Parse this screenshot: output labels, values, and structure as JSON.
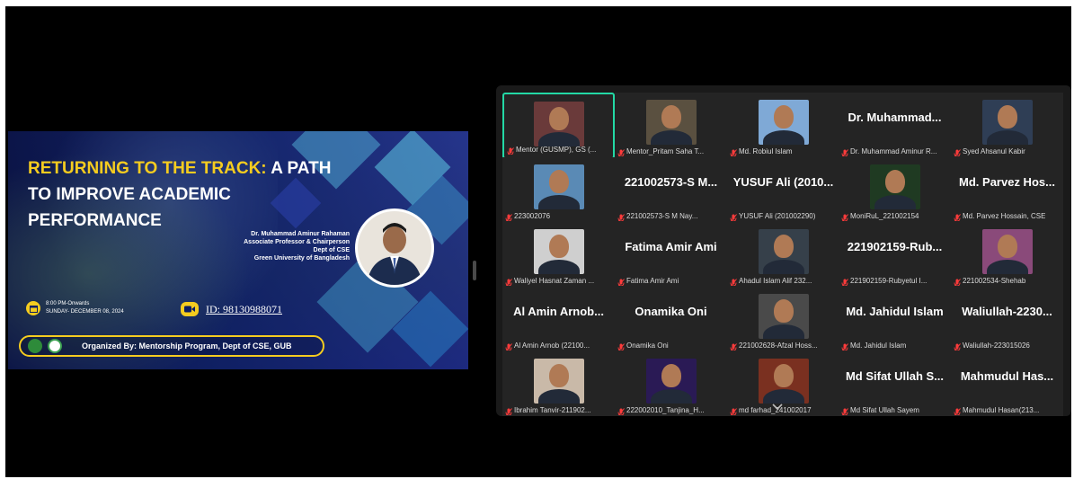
{
  "slide": {
    "title_highlight": "RETURNING TO THE TRACK:",
    "title_rest": " A PATH TO IMPROVE ACADEMIC PERFORMANCE",
    "speaker": {
      "name": "Dr. Muhammad Aminur Rahaman",
      "title": "Associate Professor & Chairperson",
      "dept": "Dept of CSE",
      "university": "Green University of Bangladesh"
    },
    "time": "8:00 PM-Onwards",
    "date": "SUNDAY- DECEMBER 08, 2024",
    "meeting_id": "ID: 98130988071",
    "organizer": "Organized By:  Mentorship Program, Dept of CSE, GUB",
    "colors": {
      "accent": "#f5cc1f",
      "background": "#0b1d63"
    }
  },
  "gallery": {
    "active_border_color": "#23d9a5",
    "tiles": [
      {
        "name": "Mentor (GUSMP), GS (...",
        "big": "",
        "avatar": "#6a3a3a"
      },
      {
        "name": "Mentor_Pritam Saha T...",
        "big": "",
        "avatar": "#5a5040"
      },
      {
        "name": "Md. Robiul Islam",
        "big": "",
        "avatar": "#7fa9d6"
      },
      {
        "name": "Dr. Muhammad Aminur R...",
        "big": "Dr. Muhammad...",
        "avatar": ""
      },
      {
        "name": "Syed Ahsanul Kabir",
        "big": "",
        "avatar": "#2f3e55"
      },
      {
        "name": "223002076",
        "big": "",
        "avatar": "#5a8ab5"
      },
      {
        "name": "221002573-S M Nay...",
        "big": "221002573-S M...",
        "avatar": ""
      },
      {
        "name": "YUSUF Ali (201002290)",
        "big": "YUSUF Ali (2010...",
        "avatar": ""
      },
      {
        "name": "MoniRuL_221002154",
        "big": "",
        "avatar": "#1f3a22"
      },
      {
        "name": "Md. Parvez Hossain, CSE",
        "big": "Md. Parvez Hos...",
        "avatar": ""
      },
      {
        "name": "Waliyel Hasnat Zaman ...",
        "big": "",
        "avatar": "#cfcfcf"
      },
      {
        "name": "Fatima Amir Ami",
        "big": "Fatima Amir Ami",
        "avatar": ""
      },
      {
        "name": "Ahadul Islam Alif 232...",
        "big": "",
        "avatar": "#36404a"
      },
      {
        "name": "221902159-Rubyetul I...",
        "big": "221902159-Rub...",
        "avatar": ""
      },
      {
        "name": "221002534-Shehab",
        "big": "",
        "avatar": "#8a4a7a"
      },
      {
        "name": "Al Amin Arnob (22100...",
        "big": "Al Amin Arnob...",
        "avatar": ""
      },
      {
        "name": "Onamika Oni",
        "big": "Onamika Oni",
        "avatar": ""
      },
      {
        "name": "221002628-Afzal Hoss...",
        "big": "",
        "avatar": "#4a4a4a"
      },
      {
        "name": "Md. Jahidul Islam",
        "big": "Md. Jahidul Islam",
        "avatar": ""
      },
      {
        "name": "Waliullah-223015026",
        "big": "Waliullah-2230...",
        "avatar": ""
      },
      {
        "name": "Ibrahim Tanvir-211902...",
        "big": "",
        "avatar": "#c9b9a8"
      },
      {
        "name": "222002010_Tanjina_H...",
        "big": "",
        "avatar": "#2a1a55"
      },
      {
        "name": "md farhad_241002017",
        "big": "",
        "avatar": "#7a3020"
      },
      {
        "name": "Md Sifat Ullah Sayem",
        "big": "Md Sifat Ullah S...",
        "avatar": ""
      },
      {
        "name": "Mahmudul Hasan(213...",
        "big": "Mahmudul Has...",
        "avatar": ""
      }
    ]
  },
  "icons": {
    "mute": "muted-mic-icon",
    "scroll": "chevron-down-icon"
  }
}
